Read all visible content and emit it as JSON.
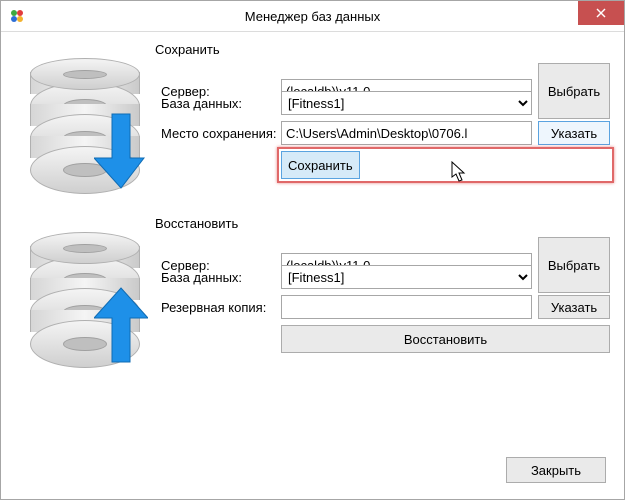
{
  "title": "Менеджер баз данных",
  "save": {
    "group_title": "Сохранить",
    "server_label": "Сервер:",
    "server_value": "(localdb)\\v11.0",
    "select_btn": "Выбрать",
    "db_label": "База данных:",
    "db_value": "[Fitness1]",
    "path_label": "Место сохранения:",
    "path_value": "C:\\Users\\Admin\\Desktop\\0706.l",
    "path_btn": "Указать",
    "action_btn": "Сохранить"
  },
  "restore": {
    "group_title": "Восстановить",
    "server_label": "Сервер:",
    "server_value": "(localdb)\\v11.0",
    "select_btn": "Выбрать",
    "db_label": "База данных:",
    "db_value": "[Fitness1]",
    "backup_label": "Резервная копия:",
    "backup_value": "",
    "backup_btn": "Указать",
    "action_btn": "Восстановить"
  },
  "close_btn": "Закрыть",
  "colors": {
    "accent_red": "#c75050",
    "hl_blue": "#d6eaf8"
  }
}
